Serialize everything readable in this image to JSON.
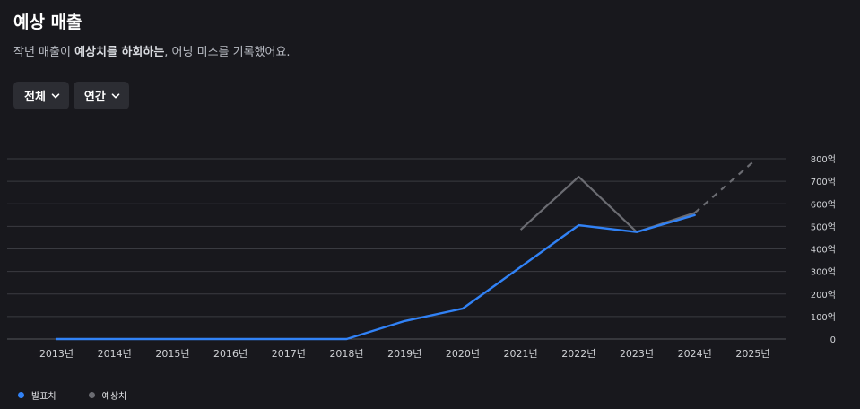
{
  "header": {
    "title": "예상 매출",
    "subtitle_prefix": "작년 매출이 ",
    "subtitle_bold": "예상치를 하회하는",
    "subtitle_suffix": ", 어닝 미스를 기록했어요."
  },
  "filters": {
    "scope_label": "전체",
    "period_label": "연간"
  },
  "legend": {
    "actual_label": "발표치",
    "estimate_label": "예상치"
  },
  "colors": {
    "actual": "#3182f6",
    "estimate": "#6b6c72",
    "grid": "#3a3b41",
    "axis_text": "#d0d2d6"
  },
  "chart_data": {
    "type": "line",
    "categories": [
      "2013년",
      "2014년",
      "2015년",
      "2016년",
      "2017년",
      "2018년",
      "2019년",
      "2020년",
      "2021년",
      "2022년",
      "2023년",
      "2024년",
      "2025년"
    ],
    "y_unit_suffix": "억",
    "y_ticks": [
      "0",
      "100억",
      "200억",
      "300억",
      "400억",
      "500억",
      "600억",
      "700억",
      "800억"
    ],
    "ylim": [
      0,
      800
    ],
    "grid": true,
    "legend_position": "bottom-left",
    "series": [
      {
        "name": "발표치",
        "values": [
          0,
          0,
          0,
          0,
          0,
          0,
          80,
          135,
          320,
          505,
          475,
          550,
          null
        ]
      },
      {
        "name": "예상치",
        "values": [
          null,
          null,
          null,
          null,
          null,
          null,
          null,
          null,
          485,
          720,
          475,
          560,
          785
        ],
        "dashed_from_index": 11
      }
    ]
  }
}
